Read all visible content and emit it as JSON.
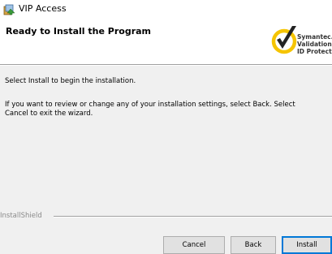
{
  "window": {
    "title": "VIP Access"
  },
  "header": {
    "title": "Ready to Install the Program",
    "logo_text": [
      "Symantec.",
      "Validation &",
      "ID Protection"
    ]
  },
  "body": {
    "instruction": "Select Install to begin the installation.",
    "details": "If you want to review or change any of your installation settings, select Back. Select Cancel to exit the wizard."
  },
  "footer": {
    "brand": "InstallShield",
    "buttons": {
      "cancel": "Cancel",
      "back": "Back",
      "install": "Install"
    }
  },
  "colors": {
    "logo_yellow": "#f5c400",
    "logo_check": "#222222",
    "focus_border": "#0078d7"
  }
}
